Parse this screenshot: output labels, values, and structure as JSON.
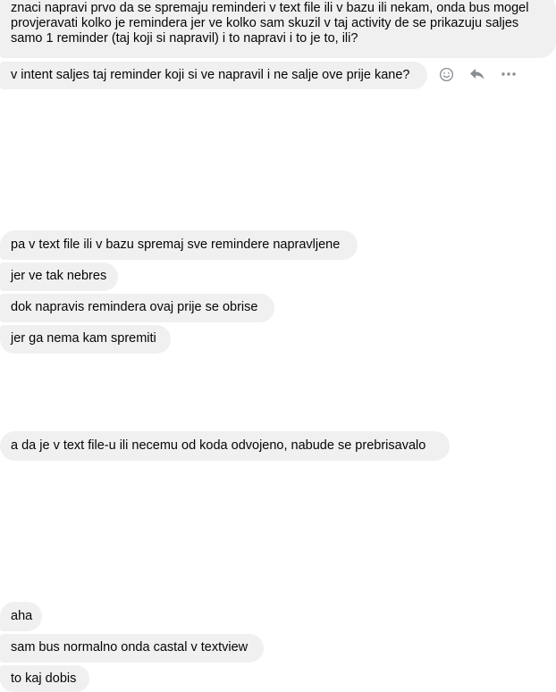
{
  "messages": [
    {
      "text": "znaci napravi prvo da se spremaju reminderi v text file ili v bazu ili nekam, onda bus mogel provjeravati kolko je remindera jer ve kolko sam skuzil v taj activity de se prikazuju saljes samo 1 reminder (taj koji si napravil) i to napravi i to je to, ili?"
    },
    {
      "text": "v intent saljes taj reminder koji si ve napravil i ne salje ove prije kane?"
    },
    {
      "text": "pa v text file ili v bazu spremaj sve remindere napravljene"
    },
    {
      "text": "jer ve tak nebres"
    },
    {
      "text": "dok napravis remindera ovaj prije se obrise"
    },
    {
      "text": "jer ga nema kam spremiti"
    },
    {
      "text": "a da je v text file-u ili necemu od koda odvojeno, nabude se prebrisavalo"
    },
    {
      "text": "aha"
    },
    {
      "text": "sam bus normalno onda castal v textview"
    },
    {
      "text": "to kaj dobis"
    }
  ],
  "message_actions": {
    "icons": [
      "smiley-icon",
      "reply-icon",
      "more-icon"
    ]
  }
}
